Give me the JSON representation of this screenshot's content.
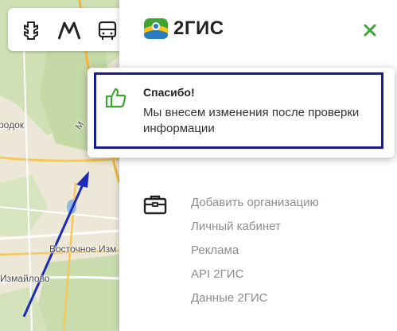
{
  "map": {
    "labels": {
      "gorodok": "родок",
      "vostochnoe": "Восточное Изм",
      "izmaylovo": "Измайлово",
      "road_m": "М"
    }
  },
  "toolbar": {
    "icons": [
      "traffic-light-icon",
      "metro-icon",
      "bus-icon"
    ]
  },
  "panel": {
    "logo_text": "2ГИС",
    "menu": [
      "Добавить организацию",
      "Личный кабинет",
      "Реклама",
      "API 2ГИС",
      "Данные 2ГИС"
    ]
  },
  "toast": {
    "title": "Спасибо!",
    "message": "Мы внесем изменения после проверки информации"
  },
  "colors": {
    "accent_green": "#3fa535",
    "frame_blue": "#1a1d8f",
    "arrow_blue": "#1d2ab8"
  }
}
